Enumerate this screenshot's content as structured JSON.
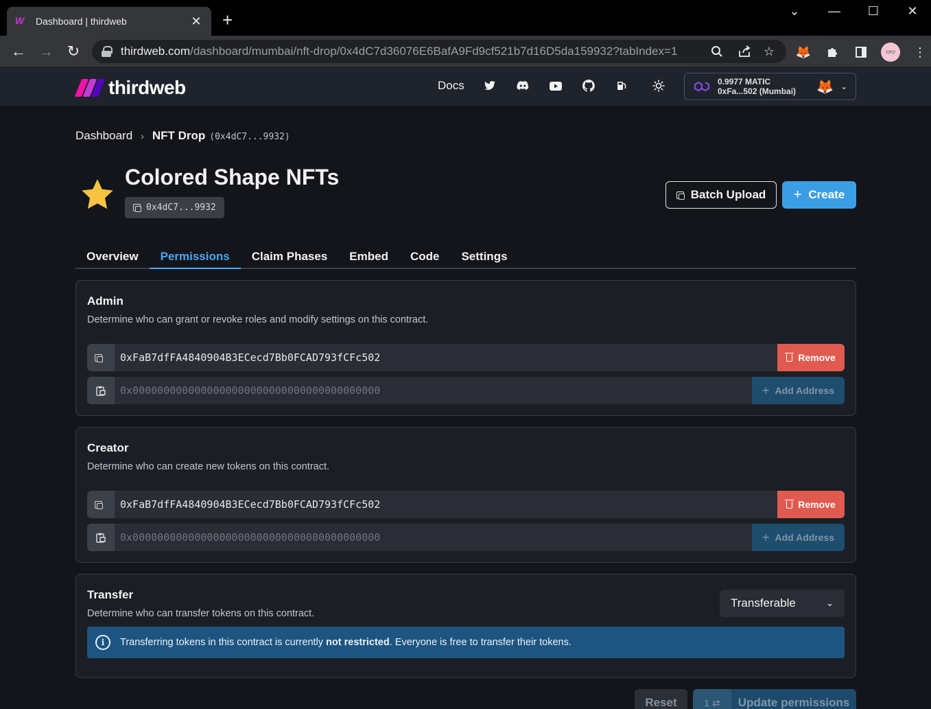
{
  "browser": {
    "tab_title": "Dashboard | thirdweb",
    "tab_close": "✕",
    "new_tab": "+",
    "url_host": "thirdweb.com",
    "url_path": "/dashboard/mumbai/nft-drop/0x4dC7d36076E6BafA9Fd9cf521b7d16D5da159932?tabIndex=1"
  },
  "header": {
    "logo_text": "thirdweb",
    "docs_label": "Docs",
    "wallet": {
      "balance": "0.9977 MATIC",
      "address": "0xFa...502 (Mumbai)"
    }
  },
  "breadcrumb": {
    "root": "Dashboard",
    "separator": "›",
    "current": "NFT Drop",
    "address": "(0x4dC7...9932)"
  },
  "contract": {
    "title": "Colored Shape NFTs",
    "short_address": "0x4dC7...9932",
    "batch_upload_label": "Batch Upload",
    "create_label": "Create"
  },
  "tabs": [
    "Overview",
    "Permissions",
    "Claim Phases",
    "Embed",
    "Code",
    "Settings"
  ],
  "active_tab": "Permissions",
  "roles": {
    "admin": {
      "title": "Admin",
      "description": "Determine who can grant or revoke roles and modify settings on this contract.",
      "address": "0xFaB7dfFA4840904B3ECecd7Bb0FCAD793fCFc502",
      "placeholder": "0x0000000000000000000000000000000000000000",
      "remove_label": "Remove",
      "add_label": "Add Address"
    },
    "creator": {
      "title": "Creator",
      "description": "Determine who can create new tokens on this contract.",
      "address": "0xFaB7dfFA4840904B3ECecd7Bb0FCAD793fCFc502",
      "placeholder": "0x0000000000000000000000000000000000000000",
      "remove_label": "Remove",
      "add_label": "Add Address"
    },
    "transfer": {
      "title": "Transfer",
      "description": "Determine who can transfer tokens on this contract.",
      "select_value": "Transferable",
      "info_prefix": "Transferring tokens in this contract is currently ",
      "info_bold": "not restricted",
      "info_suffix": ". Everyone is free to transfer their tokens."
    }
  },
  "footer": {
    "reset_label": "Reset",
    "changes_count": "1 ⇄",
    "update_label": "Update permissions"
  },
  "colors": {
    "accent": "#3b9ee5",
    "remove": "#e05a4f",
    "info": "#1e5580",
    "star": "#f6c343"
  }
}
